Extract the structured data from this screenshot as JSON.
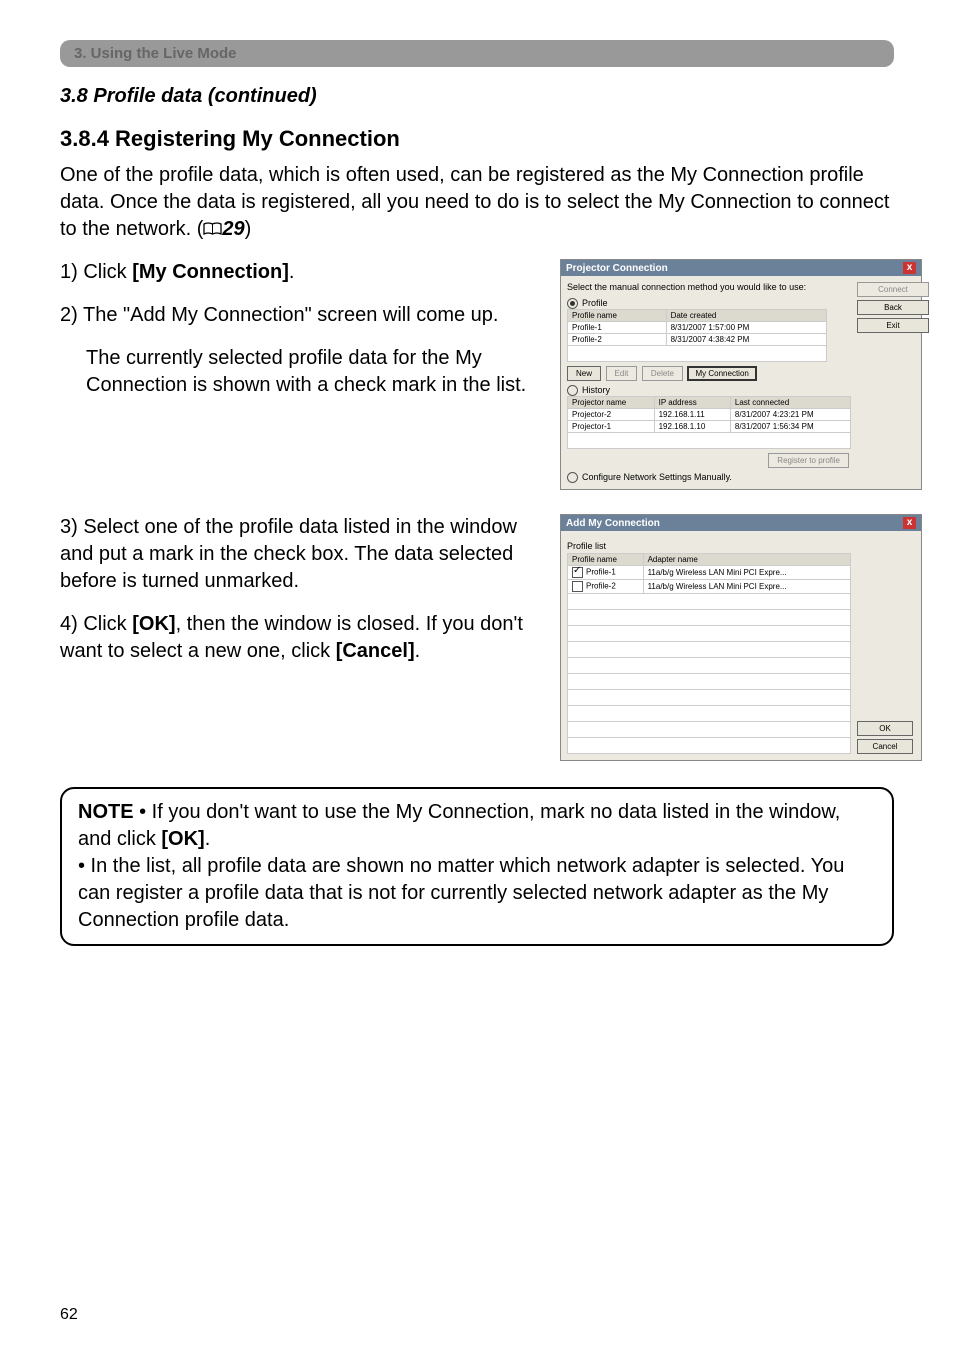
{
  "chapter_bar": "3. Using the Live Mode",
  "section_title": "3.8 Profile data (continued)",
  "subsection_title": "3.8.4 Registering My Connection",
  "intro_part1": "One of the profile data, which is often used, can be registered as the My Connection profile data. Once the data is registered, all you need to do is to select the My Connection to connect to the network. (",
  "intro_ref": "29",
  "intro_part2": ")",
  "step1_pre": "1) Click ",
  "step1_b": "[My Connection]",
  "step1_post": ".",
  "step2": "2) The \"Add My Connection\" screen will come up.",
  "step2_cont": "The currently selected profile data for the My Connection is shown with a check mark in the list.",
  "step3": "3) Select one of the profile data listed in the window and put a mark in the check box. The data selected before is turned unmarked.",
  "step4_pre": "4) Click ",
  "step4_b1": "[OK]",
  "step4_mid": ", then the window is closed. If you don't want to select a new one, click ",
  "step4_b2": "[Cancel]",
  "step4_post": ".",
  "note_label": "NOTE",
  "note_1": " • If you don't want to use the My Connection, mark no data listed in the window, and click ",
  "note_1_b": "[OK]",
  "note_1_post": ".",
  "note_2": "• In the list, all profile data are shown no matter which network adapter is selected. You can register a profile data that is not for currently selected network adapter as the My Connection profile data.",
  "page_number": "62",
  "dlg1": {
    "title": "Projector Connection",
    "instr": "Select the manual connection method you would like to use:",
    "radio_profile": "Profile",
    "th_pname": "Profile name",
    "th_date": "Date created",
    "rows": [
      {
        "name": "Profile-1",
        "date": "8/31/2007 1:57:00 PM"
      },
      {
        "name": "Profile-2",
        "date": "8/31/2007 4:38:42 PM"
      }
    ],
    "btn_new": "New",
    "btn_edit": "Edit",
    "btn_delete": "Delete",
    "btn_myconn": "My Connection",
    "radio_history": "History",
    "th_projname": "Projector name",
    "th_ip": "IP address",
    "th_last": "Last connected",
    "hrows": [
      {
        "name": "Projector-2",
        "ip": "192.168.1.11",
        "last": "8/31/2007 4:23:21 PM"
      },
      {
        "name": "Projector-1",
        "ip": "192.168.1.10",
        "last": "8/31/2007 1:56:34 PM"
      }
    ],
    "btn_register": "Register to profile",
    "radio_manual": "Configure Network Settings Manually.",
    "btn_connect": "Connect",
    "btn_back": "Back",
    "btn_exit": "Exit"
  },
  "dlg2": {
    "title": "Add My Connection",
    "list_label": "Profile list",
    "th_pname": "Profile name",
    "th_adapter": "Adapter name",
    "rows": [
      {
        "name": "Profile-1",
        "adapter": "11a/b/g Wireless LAN Mini PCI Expre...",
        "checked": true
      },
      {
        "name": "Profile-2",
        "adapter": "11a/b/g Wireless LAN Mini PCI Expre...",
        "checked": false
      }
    ],
    "btn_ok": "OK",
    "btn_cancel": "Cancel"
  }
}
